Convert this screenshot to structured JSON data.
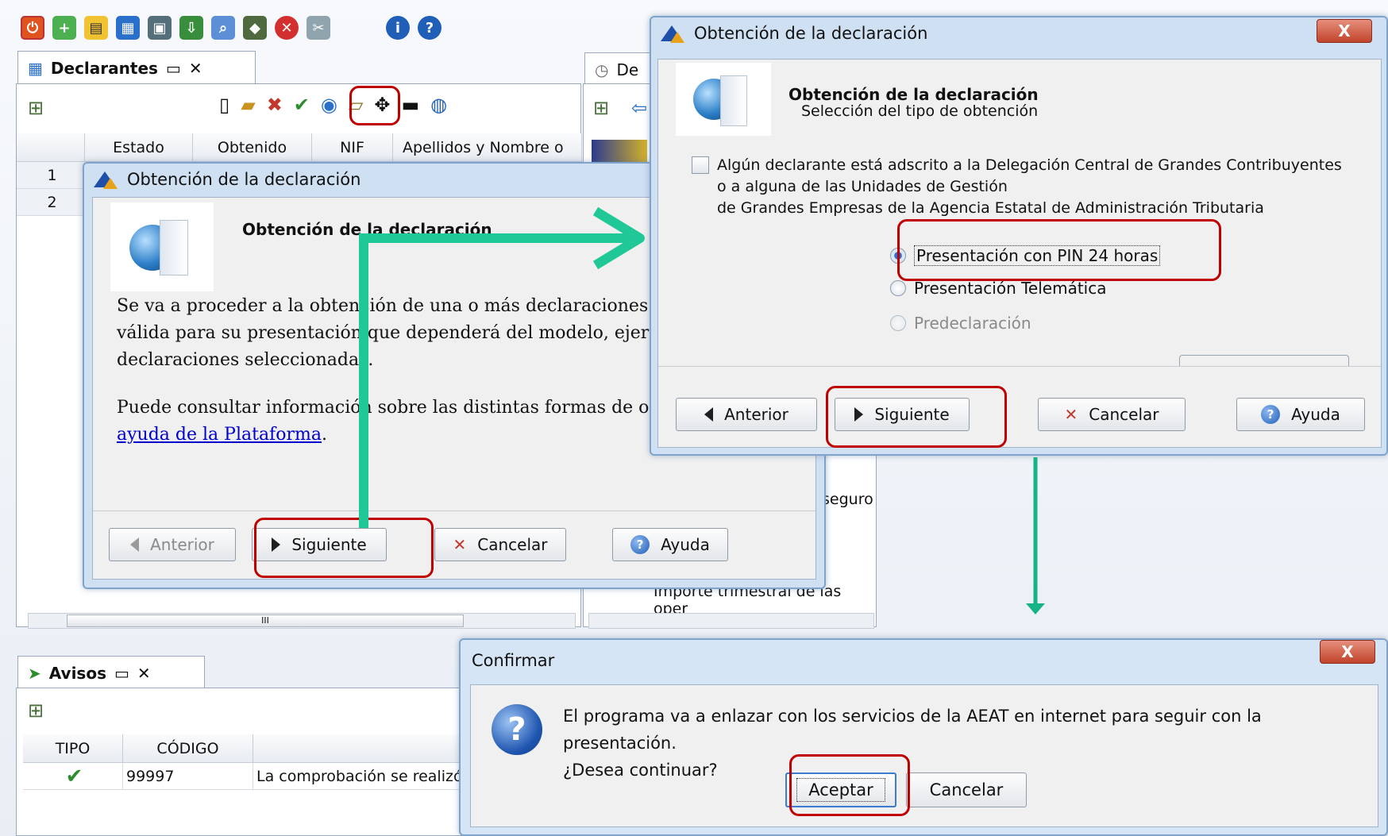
{
  "main": {
    "declarantes_tab": "Declarantes",
    "columns": [
      "Estado",
      "Obtenido",
      "NIF",
      "Apellidos y Nombre o"
    ],
    "rows": [
      "1",
      "2"
    ],
    "right_tab_partial": "De",
    "behind_text_seguro": "seguro",
    "behind_text_importe": "Importe trimestral de las oper",
    "scroll_mark": "III"
  },
  "avisos": {
    "tab": "Avisos",
    "columns": [
      "TIPO",
      "CÓDIGO"
    ],
    "row": {
      "codigo": "99997",
      "mensaje": "La comprobación se realizó"
    }
  },
  "dialog1": {
    "title": "Obtención de la declaración",
    "header": "Obtención de la declaración",
    "para1": "Se va a proceder a la obtención de una o más declaraciones en una forma válida para su presentación que dependerá del modelo, ejercicio y de las declaraciones seleccionadas.",
    "para2_pre": "Puede consultar información sobre las distintas formas de obtención en",
    "para2_link": "la ayuda de la Plataforma",
    "para2_post": ".",
    "btn_anterior": "Anterior",
    "btn_siguiente": "Siguiente",
    "btn_cancelar": "Cancelar",
    "btn_ayuda": "Ayuda"
  },
  "dialog2": {
    "title": "Obtención de la declaración",
    "header": "Obtención de la declaración",
    "subheader": "Selección del tipo de obtención",
    "checkbox_line1": "Algún declarante está adscrito a la Delegación Central de Grandes Contribuyentes",
    "checkbox_line2": "o a alguna de las Unidades de Gestión",
    "checkbox_line3": "de Grandes Empresas de la Agencia Estatal de Administración Tributaria",
    "option1": "Presentación con PIN 24 horas",
    "option2": "Presentación Telemática",
    "option3": "Predeclaración",
    "btn_anterior": "Anterior",
    "btn_siguiente": "Siguiente",
    "btn_cancelar": "Cancelar",
    "btn_ayuda": "Ayuda",
    "close": "X"
  },
  "confirm": {
    "title": "Confirmar",
    "line1": "El programa va a enlazar con los servicios de la AEAT en internet para seguir con la presentación.",
    "line2": "¿Desea continuar?",
    "btn_aceptar": "Aceptar",
    "btn_cancelar": "Cancelar",
    "close": "X"
  },
  "colors": {
    "arrow": "#1fc896",
    "highlight": "#c00000",
    "link": "#0000cc"
  }
}
